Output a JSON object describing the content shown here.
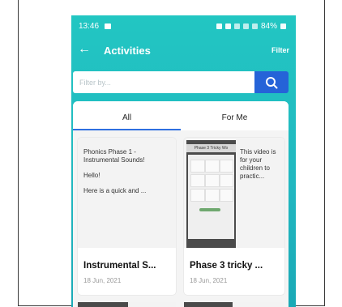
{
  "status_bar": {
    "time": "13:46",
    "battery": "84%"
  },
  "app_bar": {
    "back_icon": "←",
    "title": "Activities",
    "filter_label": "Filter"
  },
  "search": {
    "placeholder": "Filter by..."
  },
  "tabs": [
    {
      "label": "All",
      "active": true
    },
    {
      "label": "For Me",
      "active": false
    }
  ],
  "cards": [
    {
      "preview_lines": [
        "Phonics Phase 1 - Instrumental Sounds!",
        "Hello!",
        "Here is a quick and ..."
      ],
      "title": "Instrumental S...",
      "date": "18 Jun, 2021"
    },
    {
      "thumbnail_label": "Phase 3 Tricky Wo",
      "preview_text": "This video is for your children to practic...",
      "title": "Phase 3 tricky ...",
      "date": "18 Jun, 2021"
    }
  ],
  "colors": {
    "accent_teal": "#22c6c2",
    "search_blue": "#2563d8",
    "tab_underline": "#2f6fe0"
  }
}
